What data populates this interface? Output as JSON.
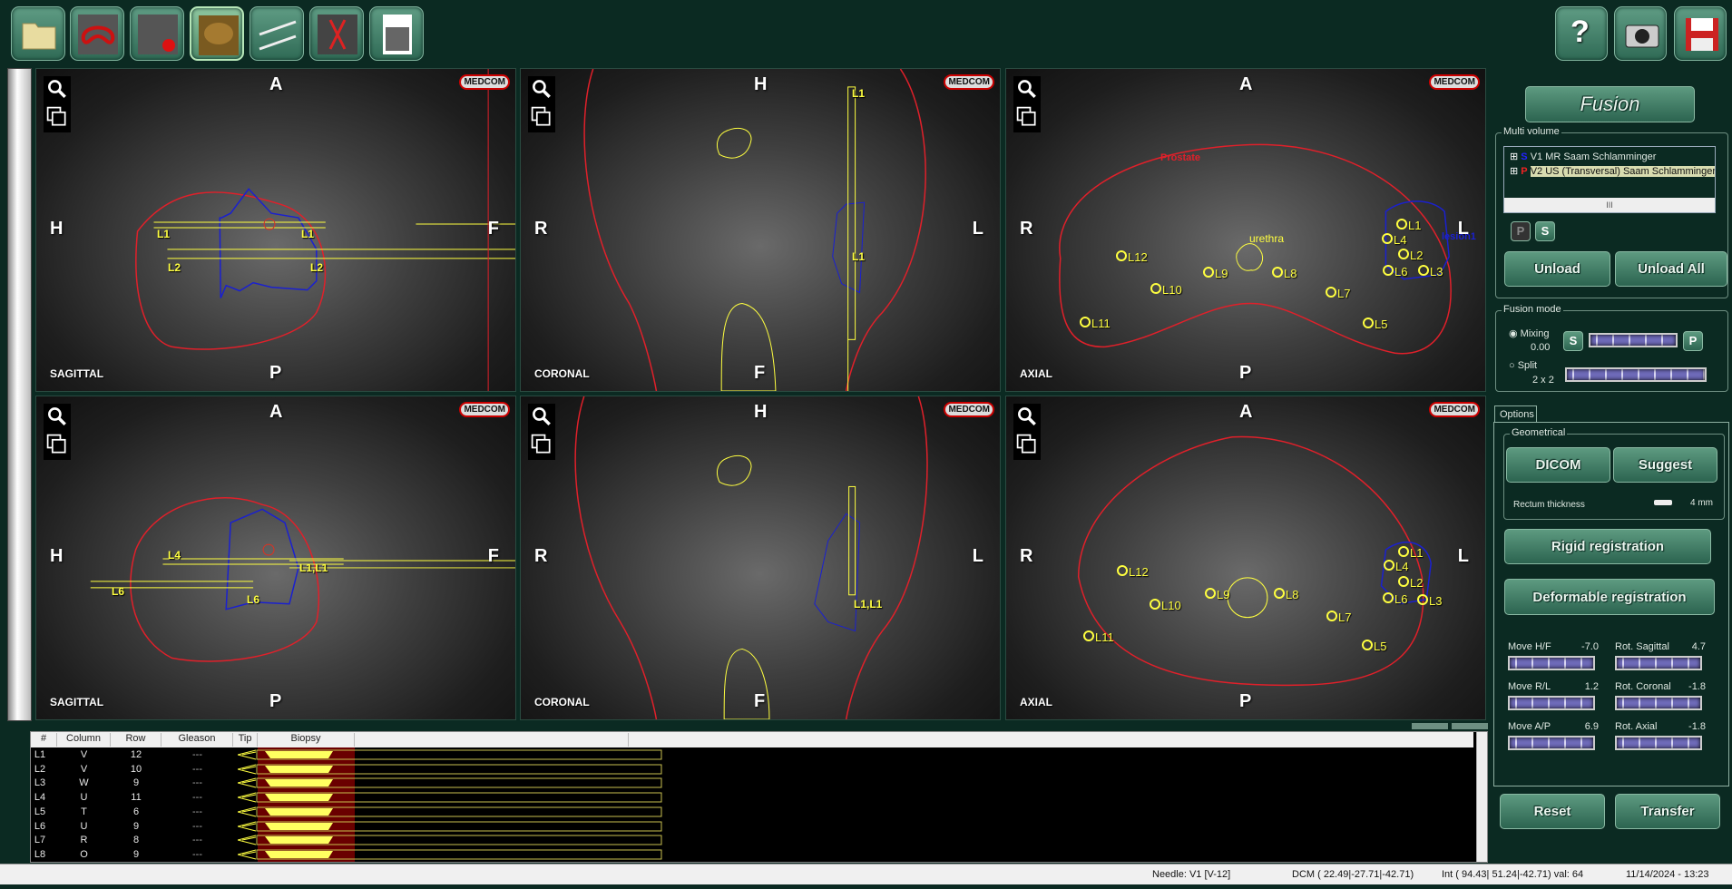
{
  "toolbar": {
    "left": [
      {
        "name": "open-folder"
      },
      {
        "name": "prostate-contour"
      },
      {
        "name": "lesion-marker"
      },
      {
        "name": "fusion"
      },
      {
        "name": "needles"
      },
      {
        "name": "biopsy-plan"
      },
      {
        "name": "report"
      }
    ],
    "right": [
      {
        "name": "help",
        "label": "?"
      },
      {
        "name": "camera"
      },
      {
        "name": "save"
      }
    ]
  },
  "views": {
    "sagittal_top": {
      "name": "SAGITTAL",
      "top": "A",
      "bottom": "P",
      "left": "H",
      "right": "F",
      "needles": [
        "L1",
        "L1",
        "L2",
        "L2"
      ]
    },
    "coronal_top": {
      "name": "CORONAL",
      "top": "H",
      "bottom": "F",
      "left": "R",
      "right": "L",
      "needles": [
        "L1",
        "L1"
      ]
    },
    "axial_top": {
      "name": "AXIAL",
      "top": "A",
      "bottom": "P",
      "left": "R",
      "right": "L",
      "prostate_label": "Prostate",
      "urethra_label": "urethra",
      "lesion_label": "lesion1",
      "markers": [
        "L1",
        "L4",
        "L2",
        "L6",
        "L3",
        "L12",
        "L9",
        "L8",
        "L10",
        "L7",
        "L11",
        "L5"
      ]
    },
    "sagittal_bottom": {
      "name": "SAGITTAL",
      "top": "A",
      "bottom": "P",
      "left": "H",
      "right": "F",
      "needles": [
        "L4",
        "L1,L1",
        "L6",
        "L6"
      ]
    },
    "coronal_bottom": {
      "name": "CORONAL",
      "top": "H",
      "bottom": "F",
      "left": "R",
      "right": "L",
      "needles": [
        "L1,L1"
      ]
    },
    "axial_bottom": {
      "name": "AXIAL",
      "top": "A",
      "bottom": "P",
      "left": "R",
      "right": "L",
      "markers": [
        "L1",
        "L4",
        "L2",
        "L6",
        "L3",
        "L12",
        "L9",
        "L8",
        "L10",
        "L7",
        "L11",
        "L5"
      ]
    },
    "logo": "MEDCOM"
  },
  "panel": {
    "fusion_title": "Fusion",
    "multi_volume": {
      "label": "Multi volume",
      "items": [
        {
          "icon": "S",
          "label": "V1 MR Saam Schlamminger"
        },
        {
          "icon": "P",
          "label": "V2 US (Transversal) Saam Schlamminger"
        }
      ],
      "scroll_grip": "III",
      "p_btn": "P",
      "s_btn": "S",
      "unload": "Unload",
      "unload_all": "Unload All"
    },
    "fusion_mode": {
      "label": "Fusion mode",
      "mixing": "Mixing",
      "mixing_value": "0.00",
      "split": "Split",
      "split_value": "2 x 2",
      "s_btn": "S",
      "p_btn": "P",
      "mode": "Mixing"
    },
    "options_tab": "Options",
    "geometrical": {
      "label": "Geometrical",
      "dicom": "DICOM",
      "suggest": "Suggest",
      "rectum_label": "Rectum thickness",
      "rectum_value": "4 mm"
    },
    "rigid": "Rigid registration",
    "deformable": "Deformable registration",
    "params": [
      {
        "label": "Move H/F",
        "value": "-7.0"
      },
      {
        "label": "Rot. Sagittal",
        "value": "4.7"
      },
      {
        "label": "Move R/L",
        "value": "1.2"
      },
      {
        "label": "Rot. Coronal",
        "value": "-1.8"
      },
      {
        "label": "Move A/P",
        "value": "6.9"
      },
      {
        "label": "Rot. Axial",
        "value": "-1.8"
      }
    ],
    "reset": "Reset",
    "transfer": "Transfer"
  },
  "table": {
    "headers": [
      "#",
      "Column",
      "Row",
      "Gleason",
      "Tip",
      "Biopsy"
    ],
    "rows": [
      [
        "L1",
        "V",
        "12",
        "---"
      ],
      [
        "L2",
        "V",
        "10",
        "---"
      ],
      [
        "L3",
        "W",
        "9",
        "---"
      ],
      [
        "L4",
        "U",
        "11",
        "---"
      ],
      [
        "L5",
        "T",
        "6",
        "---"
      ],
      [
        "L6",
        "U",
        "9",
        "---"
      ],
      [
        "L7",
        "R",
        "8",
        "---"
      ],
      [
        "L8",
        "O",
        "9",
        "---"
      ]
    ]
  },
  "status": {
    "needle": "Needle: V1 [V-12]",
    "dcm": "DCM ( 22.49|-27.71|-42.71)",
    "int": "Int ( 94.43| 51.24|-42.71) val:  64",
    "datetime": "11/14/2024 - 13:23"
  },
  "colors": {
    "prostate": "#e0202a",
    "lesion": "#1a20d0",
    "marker": "#ffff40",
    "panel_bg": "#0b2a22",
    "button": "#3f7d66"
  }
}
